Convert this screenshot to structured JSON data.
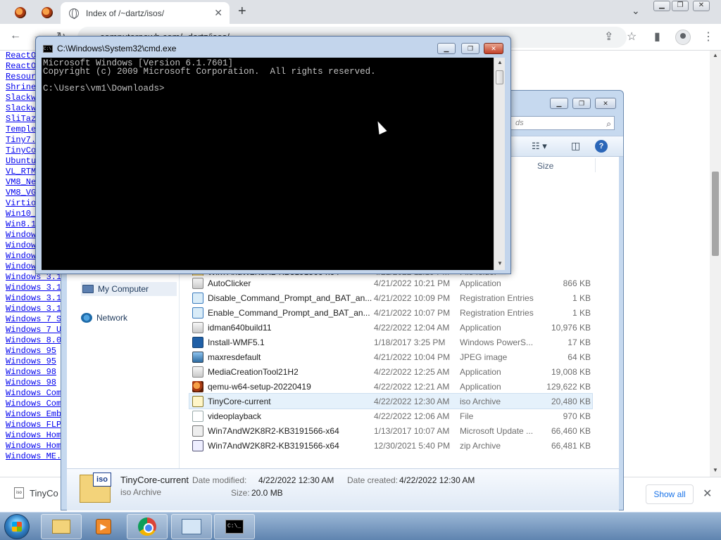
{
  "browser": {
    "active_tab_title": "Index of /~dartz/isos/",
    "address": "computernewb.com/~dartz/isos/",
    "page_links": [
      "ReactO",
      "ReactO",
      "Resour",
      "Shrine",
      "Slackw",
      "Slackw",
      "SliTaz",
      "Temple",
      "Tiny7.",
      "TinyCo",
      "Ubuntu",
      "VL_RTM",
      "VM8_Ne",
      "VM8_VG",
      "Virtio",
      "Win10_",
      "Win8.1",
      "Window",
      "Window",
      "Window",
      "Windows 3.1",
      "Windows 3.1",
      "Windows 3.1",
      "Windows 3.1",
      "Windows 3.1",
      "Windows 7 S",
      "Windows 7 U",
      "Windows 8.0",
      "Windows 95 ",
      "Windows 95 ",
      "Windows 98 ",
      "Windows 98 ",
      "Windows Com",
      "Windows Com",
      "Windows Emb",
      "Windows FLP",
      "Windows Hom",
      "Windows Hom",
      "Windows ME."
    ],
    "download_item": "TinyCo",
    "show_all_label": "Show all"
  },
  "cmd": {
    "title": "C:\\Windows\\System32\\cmd.exe",
    "lines": [
      "Microsoft Windows [Version 6.1.7601]",
      "Copyright (c) 2009 Microsoft Corporation.  All rights reserved.",
      "",
      "C:\\Users\\vm1\\Downloads>"
    ]
  },
  "explorer": {
    "search_placeholder": "ds",
    "column_size": "Size",
    "nav": {
      "my_computer": "My Computer",
      "network": "Network"
    },
    "files": [
      {
        "name": "Win7AndW2K8R2-KB3191566-x64",
        "date": "4/21/2022 11:19 PM",
        "type": "File folder",
        "size": "",
        "icon": "folder-icon"
      },
      {
        "name": "AutoClicker",
        "date": "4/21/2022 10:21 PM",
        "type": "Application",
        "size": "866 KB",
        "icon": "application-icon"
      },
      {
        "name": "Disable_Command_Prompt_and_BAT_an...",
        "date": "4/21/2022 10:09 PM",
        "type": "Registration Entries",
        "size": "1 KB",
        "icon": "registry-icon"
      },
      {
        "name": "Enable_Command_Prompt_and_BAT_an...",
        "date": "4/21/2022 10:07 PM",
        "type": "Registration Entries",
        "size": "1 KB",
        "icon": "registry-icon"
      },
      {
        "name": "idman640build11",
        "date": "4/22/2022 12:04 AM",
        "type": "Application",
        "size": "10,976 KB",
        "icon": "installer-icon"
      },
      {
        "name": "Install-WMF5.1",
        "date": "1/18/2017 3:25 PM",
        "type": "Windows PowerS...",
        "size": "17 KB",
        "icon": "powershell-icon"
      },
      {
        "name": "maxresdefault",
        "date": "4/21/2022 10:04 PM",
        "type": "JPEG image",
        "size": "64 KB",
        "icon": "image-icon"
      },
      {
        "name": "MediaCreationTool21H2",
        "date": "4/22/2022 12:25 AM",
        "type": "Application",
        "size": "19,008 KB",
        "icon": "application-icon"
      },
      {
        "name": "qemu-w64-setup-20220419",
        "date": "4/22/2022 12:21 AM",
        "type": "Application",
        "size": "129,622 KB",
        "icon": "qemu-icon"
      },
      {
        "name": "TinyCore-current",
        "date": "4/22/2022 12:30 AM",
        "type": "iso Archive",
        "size": "20,480 KB",
        "icon": "iso-icon"
      },
      {
        "name": "videoplayback",
        "date": "4/22/2022 12:06 AM",
        "type": "File",
        "size": "970 KB",
        "icon": "file-icon"
      },
      {
        "name": "Win7AndW2K8R2-KB3191566-x64",
        "date": "1/13/2017 10:07 AM",
        "type": "Microsoft Update ...",
        "size": "66,460 KB",
        "icon": "update-package-icon"
      },
      {
        "name": "Win7AndW2K8R2-KB3191566-x64",
        "date": "12/30/2021 5:40 PM",
        "type": "zip Archive",
        "size": "66,481 KB",
        "icon": "zip-icon"
      }
    ],
    "selected_file_index": 9,
    "details": {
      "name": "TinyCore-current",
      "type": "iso Archive",
      "modified_label": "Date modified:",
      "modified_value": "4/22/2022 12:30 AM",
      "created_label": "Date created:",
      "created_value": "4/22/2022 12:30 AM",
      "size_label": "Size:",
      "size_value": "20.0 MB",
      "badge": "iso"
    }
  },
  "taskbar": {
    "cmd_glyph": "C:\\_"
  }
}
